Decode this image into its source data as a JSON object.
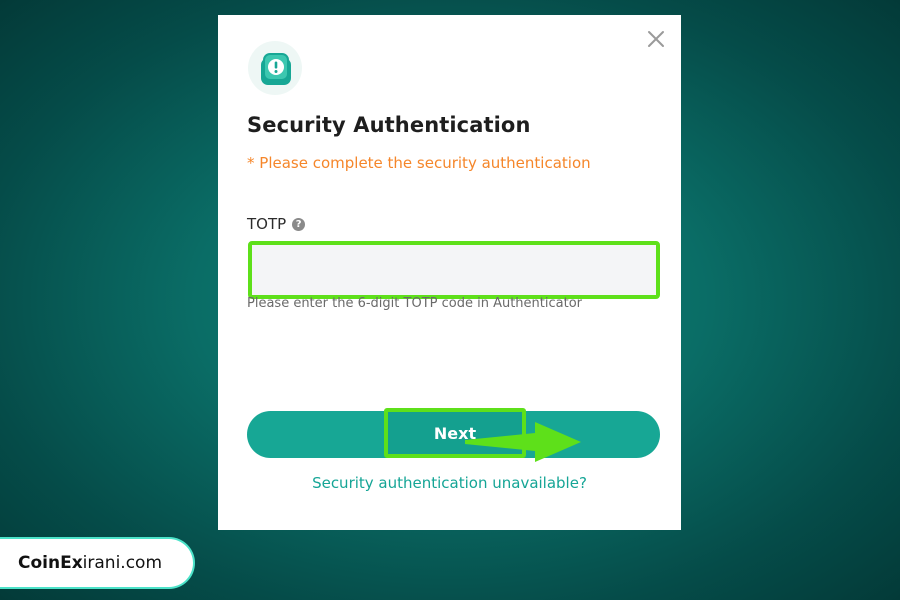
{
  "modal": {
    "title": "Security Authentication",
    "subtitle": "* Please complete the security authentication",
    "field_label": "TOTP",
    "help_glyph": "?",
    "input_value": "",
    "input_placeholder": "",
    "hint": "Please enter the 6-digit TOTP code in Authenticator",
    "next_label": "Next",
    "unavailable_link": "Security authentication unavailable?",
    "icons": {
      "close": "close-icon",
      "badge": "security-alert-icon",
      "help": "help-circle-icon",
      "arrow": "annotation-arrow-icon"
    }
  },
  "watermark": {
    "brand_bold": "CoinEx",
    "brand_rest": "irani.com"
  },
  "colors": {
    "accent": "#17a795",
    "warning": "#f5862a",
    "highlight": "#5ee01a",
    "background": "#0a6d66"
  }
}
